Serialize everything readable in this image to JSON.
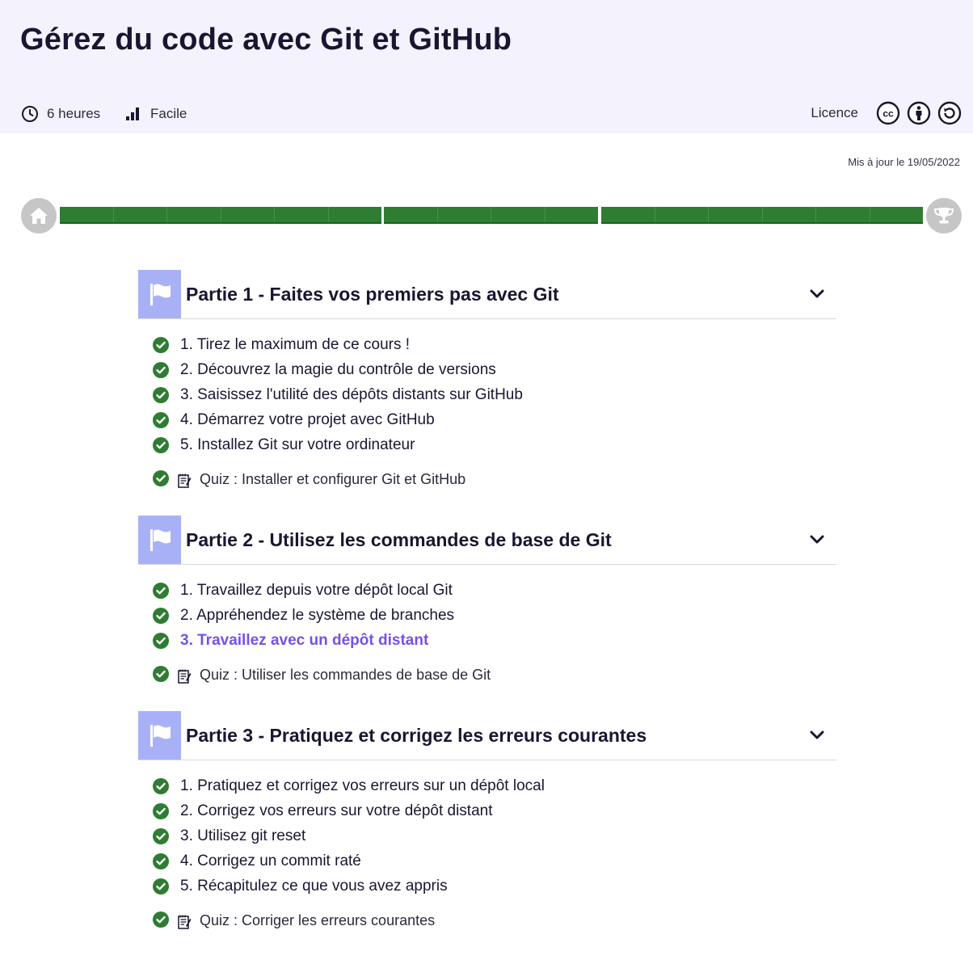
{
  "header": {
    "title": "Gérez du code avec Git et GitHub",
    "duration": "6 heures",
    "level": "Facile",
    "licence_label": "Licence",
    "licence_icons": [
      "cc-icon",
      "by-icon",
      "sa-icon"
    ]
  },
  "updated": "Mis à jour le 19/05/2022",
  "progress": {
    "completion": 1.0,
    "color": "#2e7d32",
    "parts": [
      {
        "chapters_done": 6
      },
      {
        "chapters_done": 4
      },
      {
        "chapters_done": 6
      }
    ]
  },
  "parts": [
    {
      "title": "Partie 1 - Faites vos premiers pas avec Git",
      "chapters": [
        {
          "label": "1. Tirez le maximum de ce cours !",
          "done": true
        },
        {
          "label": "2. Découvrez la magie du contrôle de versions",
          "done": true
        },
        {
          "label": "3. Saisissez l'utilité des dépôts distants sur GitHub",
          "done": true
        },
        {
          "label": "4. Démarrez votre projet avec GitHub",
          "done": true
        },
        {
          "label": "5. Installez Git sur votre ordinateur",
          "done": true
        }
      ],
      "quiz": "Quiz : Installer et configurer Git et GitHub"
    },
    {
      "title": "Partie 2 - Utilisez les commandes de base de Git",
      "chapters": [
        {
          "label": "1. Travaillez depuis votre dépôt local Git",
          "done": true
        },
        {
          "label": "2. Appréhendez le système de branches",
          "done": true
        },
        {
          "label": "3. Travaillez avec un dépôt distant",
          "done": true,
          "current": true
        }
      ],
      "quiz": "Quiz : Utiliser les commandes de base de Git"
    },
    {
      "title": "Partie 3 - Pratiquez et corrigez les erreurs courantes",
      "chapters": [
        {
          "label": "1. Pratiquez et corrigez vos erreurs sur un dépôt local",
          "done": true
        },
        {
          "label": "2. Corrigez vos erreurs sur votre dépôt distant",
          "done": true
        },
        {
          "label": "3. Utilisez git reset",
          "done": true
        },
        {
          "label": "4. Corrigez un commit raté",
          "done": true
        },
        {
          "label": "5. Récapitulez ce que vous avez appris",
          "done": true
        }
      ],
      "quiz": "Quiz : Corriger les erreurs courantes"
    }
  ],
  "colors": {
    "accent": "#7451eb",
    "check": "#2e7d32",
    "flag_bg": "#a9b1f6",
    "header_bg": "#f3f2fd"
  }
}
